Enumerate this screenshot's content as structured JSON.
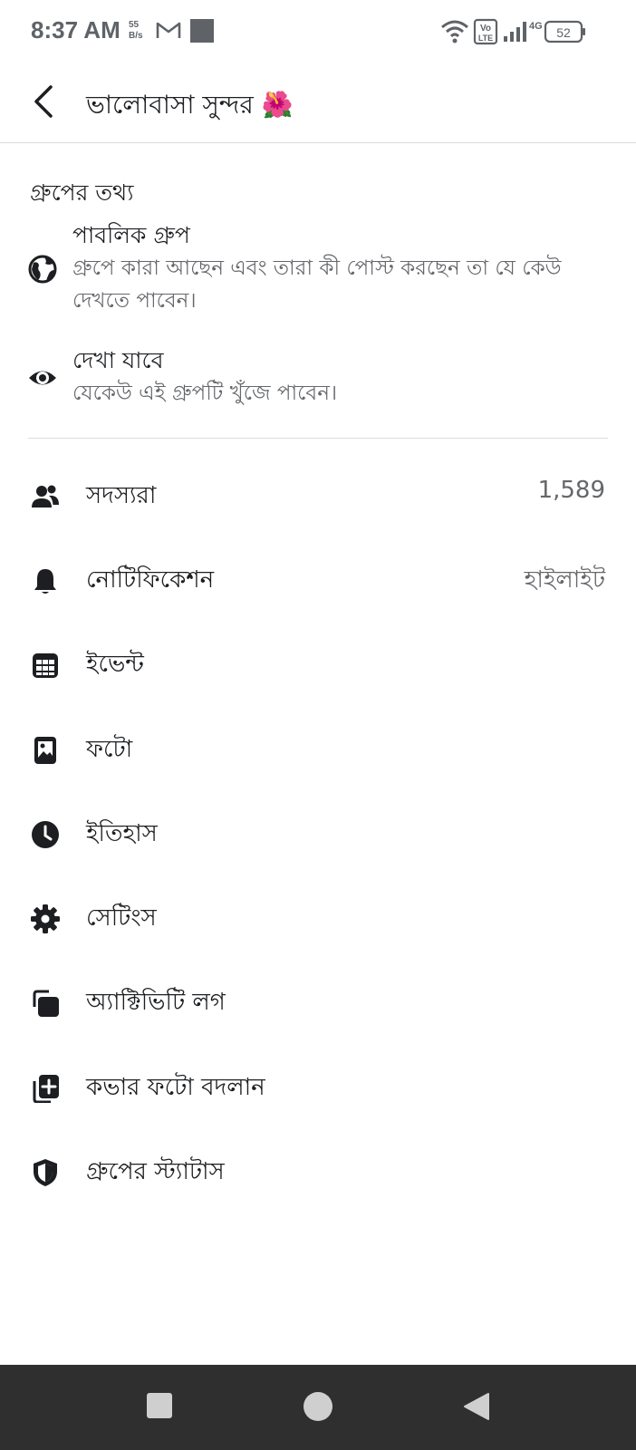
{
  "status_bar": {
    "time": "8:37 AM",
    "speed_value": "55",
    "speed_unit": "B/s",
    "battery": "52",
    "network": "4G",
    "volte": "Vo LTE"
  },
  "header": {
    "title": "ভালোবাসা সুন্দর 🌺"
  },
  "group_info": {
    "section_title": "গ্রুপের তথ্য",
    "privacy": {
      "heading": "পাবলিক গ্রুপ",
      "description": "গ্রুপে কারা আছেন এবং তারা কী পোস্ট করছেন তা যে কেউ দেখতে পাবেন।",
      "icon": "globe-icon"
    },
    "visibility": {
      "heading": "দেখা যাবে",
      "description": "যেকেউ এই গ্রুপটি খুঁজে পাবেন।",
      "icon": "eye-icon"
    }
  },
  "menu": [
    {
      "label": "সদস্যরা",
      "value": "1,589",
      "icon": "members-icon"
    },
    {
      "label": "নোটিফিকেশন",
      "value": "হাইলাইট",
      "icon": "bell-icon"
    },
    {
      "label": "ইভেন্ট",
      "value": "",
      "icon": "calendar-icon"
    },
    {
      "label": "ফটো",
      "value": "",
      "icon": "photo-icon"
    },
    {
      "label": "ইতিহাস",
      "value": "",
      "icon": "clock-icon"
    },
    {
      "label": "সেটিংস",
      "value": "",
      "icon": "gear-icon"
    },
    {
      "label": "অ্যাক্টিভিটি লগ",
      "value": "",
      "icon": "activity-log-icon"
    },
    {
      "label": "কভার ফটো বদলান",
      "value": "",
      "icon": "add-photo-icon"
    },
    {
      "label": "গ্রুপের স্ট্যাটাস",
      "value": "",
      "icon": "shield-icon"
    }
  ],
  "colors": {
    "text_primary": "#1c1e21",
    "text_secondary": "#65676b",
    "nav_bar": "#2f2f2f"
  }
}
